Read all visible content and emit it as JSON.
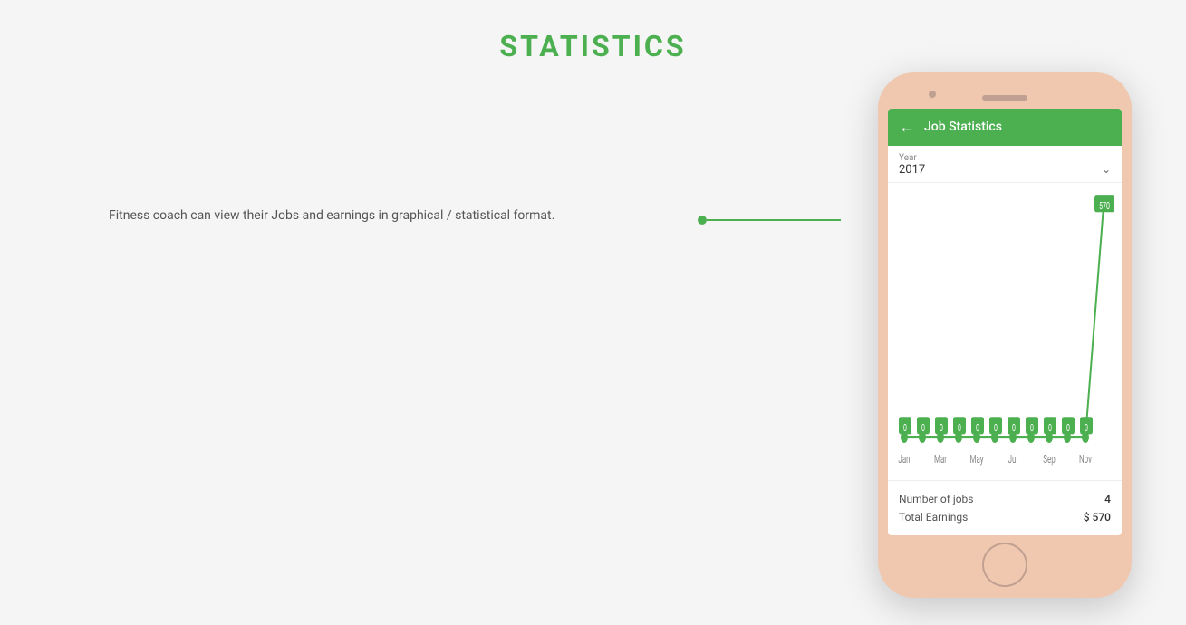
{
  "page": {
    "title": "STATISTICS",
    "description": "Fitness coach can view their Jobs and earnings in graphical / statistical format."
  },
  "phone": {
    "app_title": "Job Statistics",
    "year_label": "Year",
    "year_value": "2017",
    "chart": {
      "months": [
        "Jan",
        "Mar",
        "May",
        "Jul",
        "Sep",
        "Nov"
      ],
      "data_points": [
        0,
        0,
        0,
        0,
        0,
        0,
        0,
        0,
        0,
        0,
        0,
        570
      ],
      "peak_label": "570",
      "accent_color": "#4caf50"
    },
    "stats": {
      "number_of_jobs_label": "Number of jobs",
      "number_of_jobs_value": "4",
      "total_earnings_label": "Total Earnings",
      "total_earnings_value": "$ 570"
    }
  },
  "connector": {
    "dot_color": "#4caf50"
  }
}
